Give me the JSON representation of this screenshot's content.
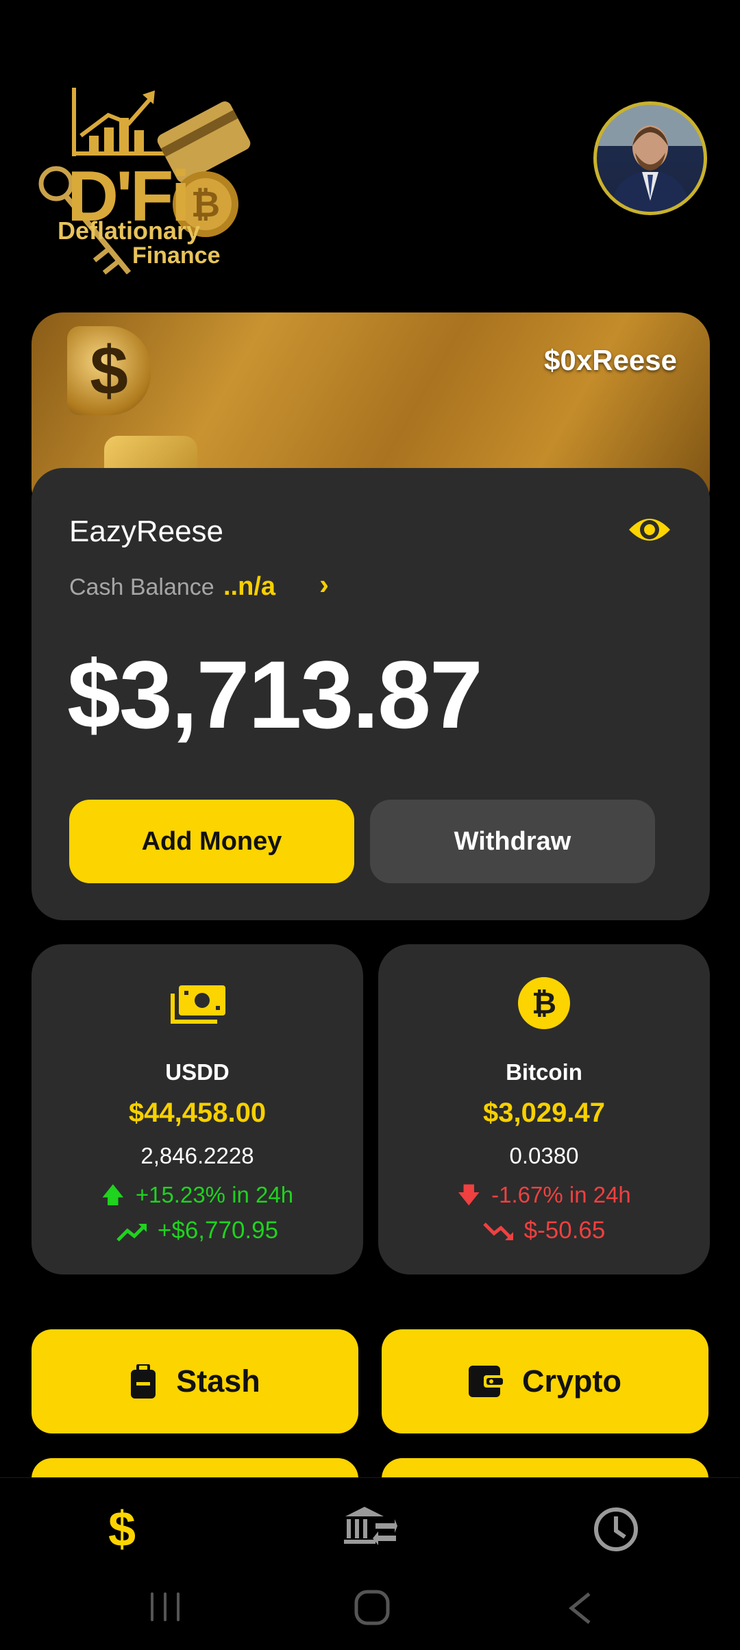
{
  "header": {
    "logo_title": "D'Fi",
    "logo_subtitle_1": "Deflationary",
    "logo_subtitle_2": "Finance"
  },
  "card": {
    "handle": "$0xReese"
  },
  "account": {
    "username": "EazyReese",
    "cash_label": "Cash Balance",
    "cash_value": "..n/a",
    "balance": "$3,713.87",
    "add_money_label": "Add Money",
    "withdraw_label": "Withdraw"
  },
  "assets": [
    {
      "name": "USDD",
      "usd_value": "$44,458.00",
      "amount": "2,846.2228",
      "pct_change": "+15.23% in 24h",
      "value_change": "+$6,770.95",
      "trend": "up",
      "icon": "cash-icon"
    },
    {
      "name": "Bitcoin",
      "usd_value": "$3,029.47",
      "amount": "0.0380",
      "pct_change": "-1.67% in 24h",
      "value_change": "$-50.65",
      "trend": "down",
      "icon": "bitcoin-icon"
    }
  ],
  "actions": {
    "stash_label": "Stash",
    "crypto_label": "Crypto"
  },
  "nav": {
    "items": [
      "dollar-icon",
      "bank-transfer-icon",
      "history-clock-icon"
    ],
    "active": "dollar-icon",
    "dollar_glyph": "$"
  },
  "colors": {
    "accent": "#fcd400",
    "panel": "#2c2c2c",
    "positive": "#1fd31f",
    "negative": "#f04040"
  }
}
